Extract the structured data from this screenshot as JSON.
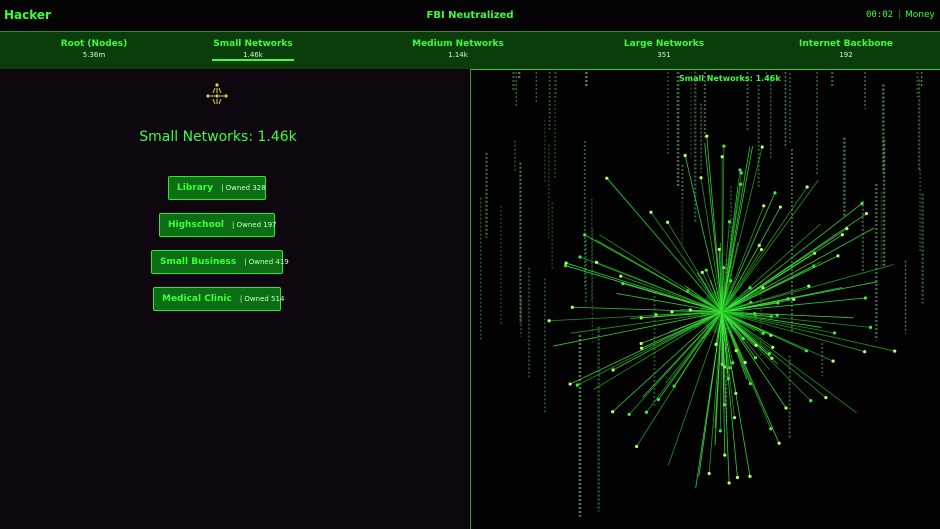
{
  "app": {
    "title": "Hacker",
    "status": "FBI Neutralized",
    "timer": "00:02",
    "separator": "|",
    "money_label": "Money"
  },
  "tabs": [
    {
      "label": "Root (Nodes)",
      "count": "5.36m"
    },
    {
      "label": "Small Networks",
      "count": "1.46k",
      "selected": true
    },
    {
      "label": "Medium Networks",
      "count": "1.14k"
    },
    {
      "label": "Large Networks",
      "count": "351"
    },
    {
      "label": "Internet Backbone",
      "count": "192"
    }
  ],
  "panel": {
    "title": "Small Networks: 1.46k",
    "viz_label": "Small Networks: 1.46k"
  },
  "targets": [
    {
      "name": "Library",
      "owned": "| Owned 328"
    },
    {
      "name": "Highschool",
      "owned": "| Owned 197"
    },
    {
      "name": "Small Business",
      "owned": "| Owned 419"
    },
    {
      "name": "Medical Clinic",
      "owned": "| Owned 514"
    }
  ],
  "colors": {
    "accent": "#39ff39",
    "button_bg": "#0c6e14",
    "tab_bar_bg": "#0b3d0b",
    "panel_bg": "#0e0710"
  },
  "icons": [
    "network-node-icon"
  ]
}
